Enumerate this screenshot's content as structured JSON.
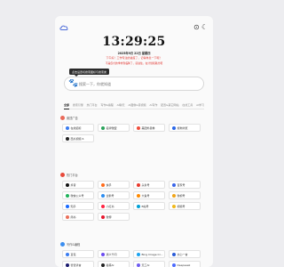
{
  "header": {
    "home_icon": "cloud-home-icon",
    "pin_icon": "pin-icon",
    "moon_icon": "moon-icon",
    "time": "13:29:25",
    "date": "2025年9月 22日 星期四",
    "notice1": "下午好！工作专注的进度了，记得休息一下呢！",
    "notice2": "不是仅付的季非到临降了，就进住，在计划和路分吧"
  },
  "search": {
    "tooltip": "点击设置切搜索图标与搜索类",
    "placeholder": "搜索一下，你就知道"
  },
  "engines": {
    "tabs": [
      "全部",
      "搜索引擎",
      "热门平台",
      "写作&编程",
      "AI聊天",
      "AI图像&音视频",
      "AI写作",
      "配置&其它网站",
      "在线工具",
      "AI学习"
    ]
  },
  "sections": [
    {
      "title": "置顶广告",
      "color": "#e96a5a",
      "items": [
        {
          "label": "在线招标",
          "color": "#3b7cf0"
        },
        {
          "label": "名牌微盟",
          "color": "#2ba35b"
        },
        {
          "label": "美团外卖券",
          "color": "#f04d3b"
        },
        {
          "label": "搜狗浏览",
          "color": "#2b67e8"
        },
        {
          "label": "西瓜视频 6",
          "color": "#222222"
        }
      ]
    },
    {
      "title": "热门平台",
      "color": "#e84b3c",
      "items": [
        {
          "label": "抖音",
          "color": "#111111"
        },
        {
          "label": "快手",
          "color": "#ff6b1a"
        },
        {
          "label": "头条号",
          "color": "#e8382c"
        },
        {
          "label": "百家号",
          "color": "#3864e8"
        },
        {
          "label": "微信公众号",
          "color": "#1fb25a"
        },
        {
          "label": "企鹅号",
          "color": "#2b8cf0"
        },
        {
          "label": "大鱼号",
          "color": "#ff8a00"
        },
        {
          "label": "微视号",
          "color": "#f0a417"
        },
        {
          "label": "知乎",
          "color": "#1769ff"
        },
        {
          "label": "小红书",
          "color": "#ff2442"
        },
        {
          "label": "B站号",
          "color": "#00a1d6"
        },
        {
          "label": "视频号",
          "color": "#f0b81a"
        },
        {
          "label": "简书",
          "color": "#ea6f5a"
        },
        {
          "label": "微博",
          "color": "#e6162d"
        }
      ]
    },
    {
      "title": "写作&编程",
      "color": "#3b8ef0",
      "items": [
        {
          "label": "豆包",
          "color": "#3b7cf0"
        },
        {
          "label": "通义千问",
          "color": "#6b4cf0"
        },
        {
          "label": "Bing Image Cr...",
          "color": "#1aa3f0"
        },
        {
          "label": "文心一言",
          "color": "#2a5bd7"
        },
        {
          "label": "智谱清言",
          "color": "#1a1a6e"
        },
        {
          "label": "秘塔AI",
          "color": "#222222"
        },
        {
          "label": "天工AI",
          "color": "#6f5cf0"
        },
        {
          "label": "Deepseek",
          "color": "#4d6bfe"
        }
      ]
    }
  ]
}
